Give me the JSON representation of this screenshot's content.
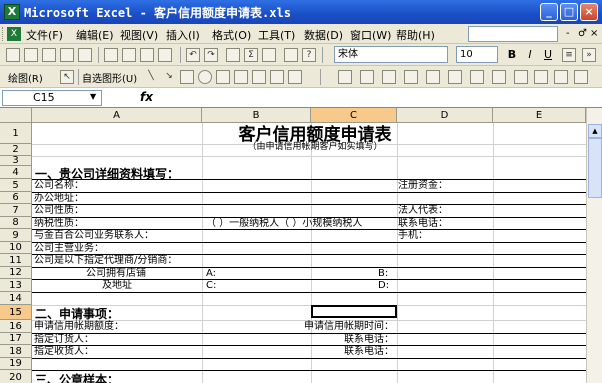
{
  "window": {
    "title": "Microsoft Excel - 客户信用额度申请表.xls",
    "icon": "excel-icon"
  },
  "menu": {
    "items": [
      "文件(F)",
      "编辑(E)",
      "视图(V)",
      "插入(I)",
      "格式(O)",
      "工具(T)",
      "数据(D)",
      "窗口(W)",
      "帮助(H)"
    ],
    "mdi_buttons": [
      "-",
      "♂",
      "×"
    ]
  },
  "toolbar": {
    "font_name": "宋体",
    "font_size": "10",
    "bold": "B",
    "italic": "I",
    "underline": "U",
    "draw_label": "绘图(R)",
    "autoshape_label": "自选图形(U)"
  },
  "formula": {
    "cell_ref": "C15",
    "fx": "fx"
  },
  "grid": {
    "columns": [
      "A",
      "B",
      "C",
      "D",
      "E"
    ],
    "selected_column": "C",
    "rows": [
      "1",
      "2",
      "3",
      "4",
      "5",
      "6",
      "7",
      "8",
      "9",
      "10",
      "11",
      "12",
      "13",
      "14",
      "15",
      "16",
      "17",
      "18",
      "19",
      "20"
    ],
    "selected_row": "15"
  },
  "sheet": {
    "title": "客户信用额度申请表",
    "subtitle": "（由申请信用帐期客户如实填写）",
    "section1": "一、贵公司详细资料填写：",
    "company_name": "公司名称：",
    "reg_capital": "注册资金：",
    "office_addr": "办公地址：",
    "company_nature": "公司性质：",
    "legal_rep": "法人代表：",
    "tax_nature": "纳税性质：",
    "taxpayer_general": "（    ）一般纳税人（    ）小规模纳税人",
    "contact_phone": "联系电话：",
    "baihe_contact": "与金百合公司业务联系人：",
    "mobile": "手机：",
    "main_business": "公司主营业务：",
    "agents": "公司是以下指定代理商/分销商：",
    "own_stores": "公司拥有店铺",
    "a1": "A:",
    "b1": "B:",
    "address": "及地址",
    "c1": "C:",
    "d1": "D:",
    "section2": "二、申请事项：",
    "credit_limit": "申请信用帐期额度：",
    "credit_time": "申请信用帐期时间：",
    "orderer": "指定订货人：",
    "orderer_phone": "联系电话：",
    "receiver": "指定收货人：",
    "receiver_phone": "联系电话：",
    "section3": "三、公章样本："
  }
}
